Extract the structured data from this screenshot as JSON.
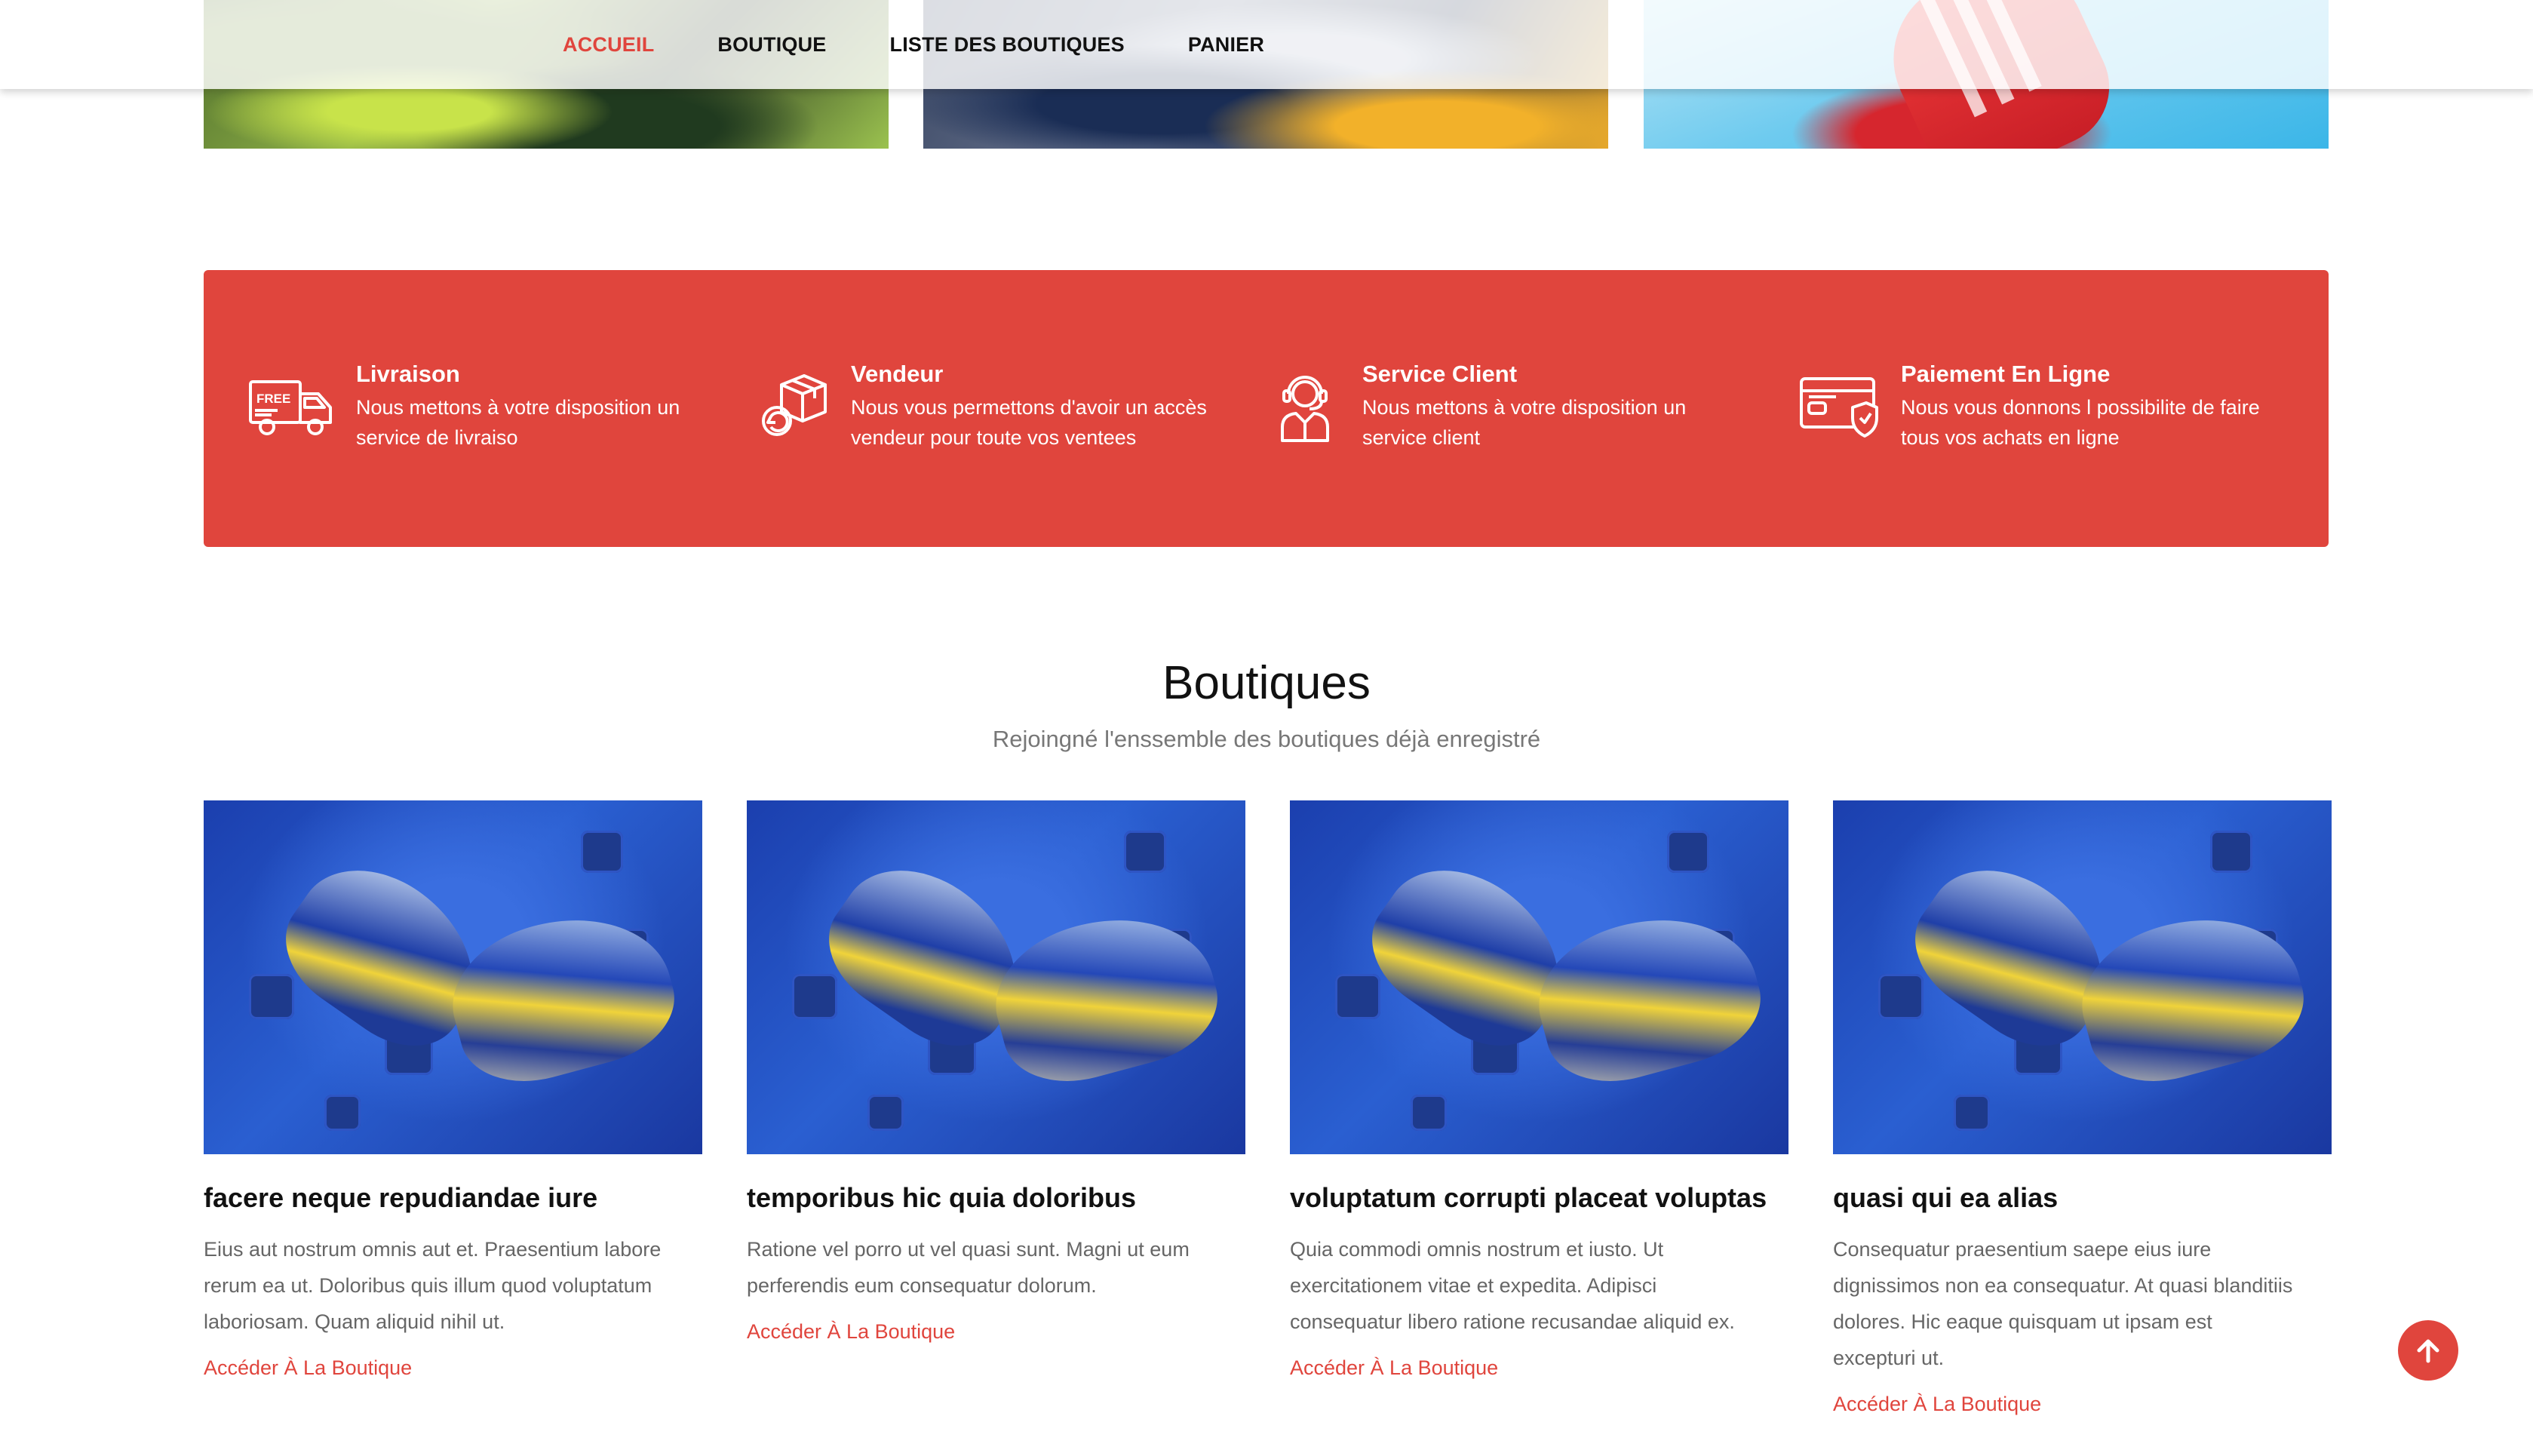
{
  "nav": {
    "items": [
      {
        "label": "ACCUEIL",
        "active": true
      },
      {
        "label": "BOUTIQUE",
        "active": false
      },
      {
        "label": "LISTE DES BOUTIQUES",
        "active": false
      },
      {
        "label": "PANIER",
        "active": false
      }
    ]
  },
  "features": [
    {
      "icon": "free-delivery-truck-icon",
      "title": "Livraison",
      "desc_line1": "Nous mettons à votre disposition un",
      "desc_line2": "service de livraiso"
    },
    {
      "icon": "box-return-icon",
      "title": "Vendeur",
      "desc_line1": "Nous vous permettons d'avoir un accès",
      "desc_line2": "vendeur pour toute vos ventees"
    },
    {
      "icon": "customer-service-headset-icon",
      "title": "Service Client",
      "desc_line1": "Nous mettons à votre disposition un",
      "desc_line2": "service client"
    },
    {
      "icon": "secure-payment-card-icon",
      "title": "Paiement En Ligne",
      "desc_line1": "Nous vous donnons l possibilite de faire",
      "desc_line2": "tous vos achats en ligne"
    }
  ],
  "shops_section": {
    "title": "Boutiques",
    "subtitle": "Rejoingné l'enssemble des boutiques déjà enregistré"
  },
  "shops": [
    {
      "name": "facere neque repudiandae iure",
      "desc_lines": [
        "Eius aut nostrum omnis aut et. Praesentium labore",
        "rerum ea ut. Doloribus quis illum quod voluptatum",
        "laboriosam. Quam aliquid nihil ut."
      ],
      "link": "Accéder À La Boutique"
    },
    {
      "name": "temporibus hic quia doloribus",
      "desc_lines": [
        "Ratione vel porro ut vel quasi sunt. Magni ut eum",
        "perferendis eum consequatur dolorum."
      ],
      "link": "Accéder À La Boutique"
    },
    {
      "name": "voluptatum corrupti placeat voluptas",
      "desc_lines": [
        "Quia commodi omnis nostrum et iusto. Ut",
        "exercitationem vitae et expedita. Adipisci",
        "consequatur libero ratione recusandae aliquid ex."
      ],
      "link": "Accéder À La Boutique"
    },
    {
      "name": "quasi qui ea alias",
      "desc_lines": [
        "Consequatur praesentium saepe eius iure",
        "dignissimos non ea consequatur. At quasi blanditiis",
        "dolores. Hic eaque quisquam ut ipsam est",
        "excepturi ut."
      ],
      "link": "Accéder À La Boutique"
    }
  ],
  "colors": {
    "accent": "#e0453d",
    "text": "#111111",
    "muted": "#777777"
  },
  "back_to_top": {
    "icon": "arrow-up-icon"
  }
}
